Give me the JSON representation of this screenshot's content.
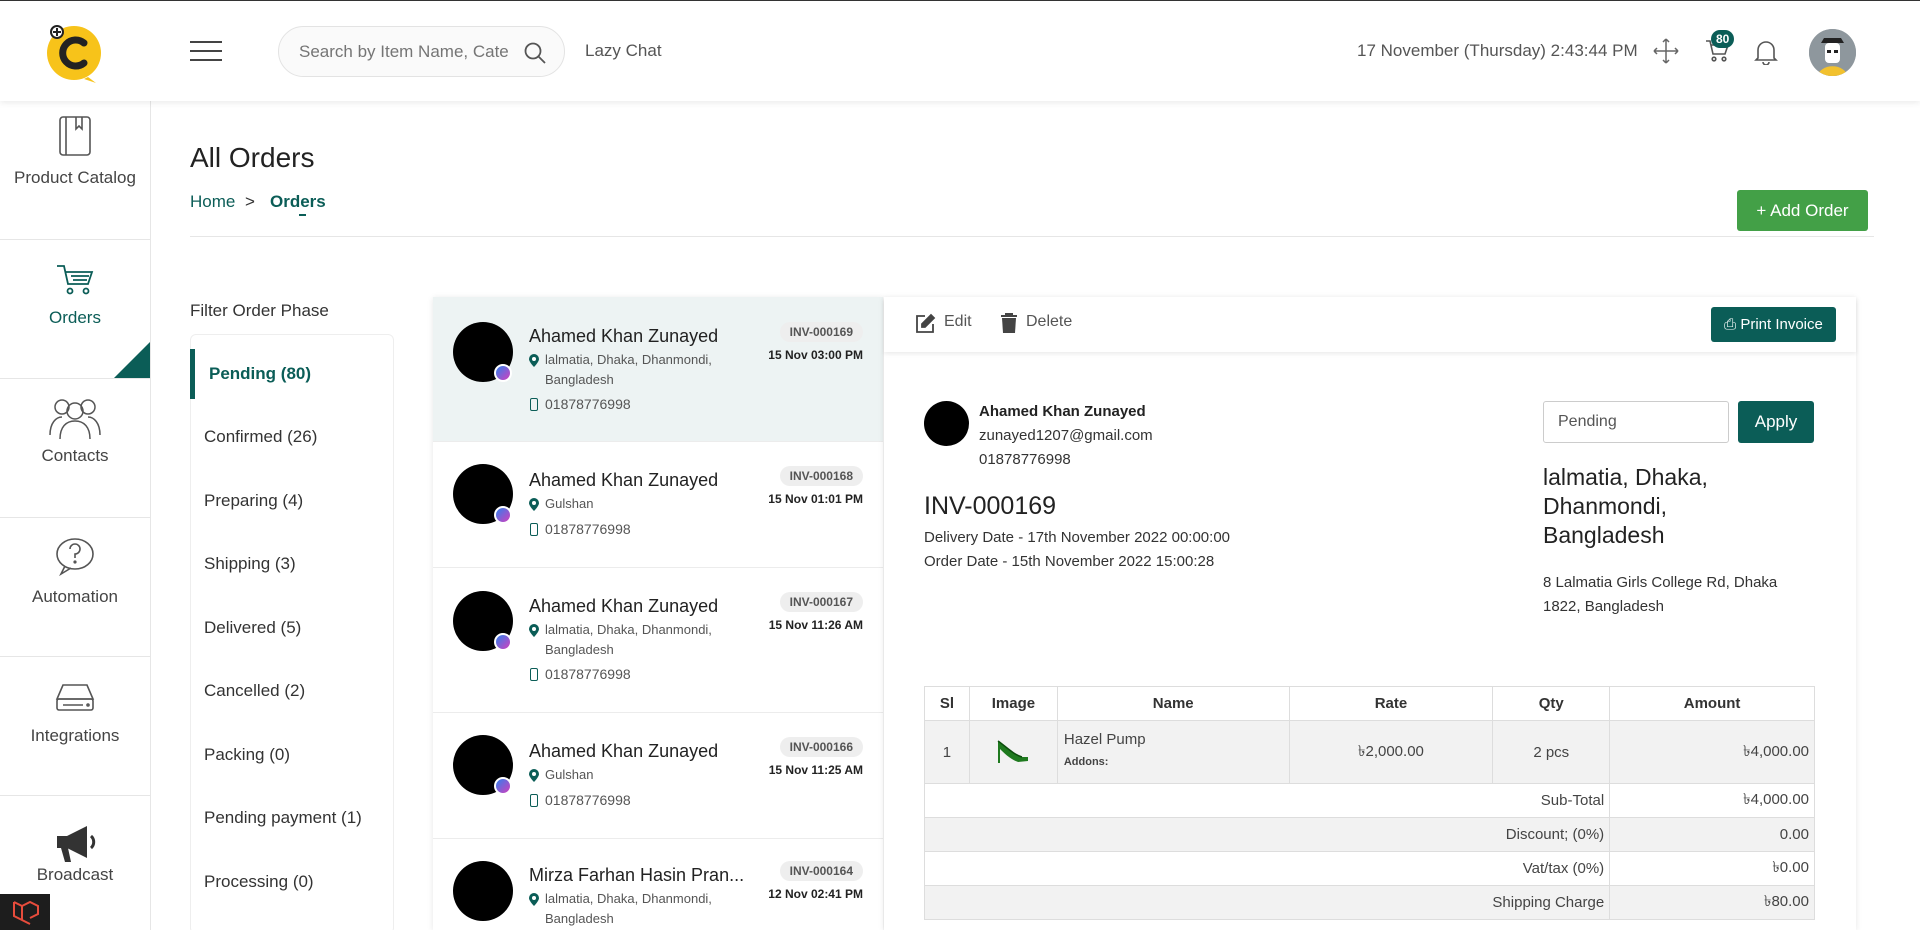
{
  "header": {
    "search_placeholder": "Search by Item Name, Category",
    "lazy_chat": "Lazy Chat",
    "datetime": "17 November (Thursday) 2:43:44 PM",
    "cart_count": "80"
  },
  "sidebar": {
    "items": [
      {
        "label": "Product Catalog"
      },
      {
        "label": "Orders"
      },
      {
        "label": "Contacts"
      },
      {
        "label": "Automation"
      },
      {
        "label": "Integrations"
      },
      {
        "label": "Broadcast"
      }
    ]
  },
  "page": {
    "title": "All Orders",
    "breadcrumb_home": "Home",
    "breadcrumb_sep": ">",
    "breadcrumb_current": "Orders",
    "add_order": "+ Add Order"
  },
  "filter": {
    "title": "Filter Order Phase",
    "items": [
      {
        "label": "Pending (80)"
      },
      {
        "label": "Confirmed (26)"
      },
      {
        "label": "Preparing (4)"
      },
      {
        "label": "Shipping (3)"
      },
      {
        "label": "Delivered (5)"
      },
      {
        "label": "Cancelled (2)"
      },
      {
        "label": "Packing (0)"
      },
      {
        "label": "Pending payment (1)"
      },
      {
        "label": "Processing (0)"
      }
    ]
  },
  "orders": [
    {
      "name": "Ahamed Khan Zunayed",
      "location": "lalmatia, Dhaka, Dhanmondi, Bangladesh",
      "phone": "01878776998",
      "invoice": "INV-000169",
      "date": "15 Nov 03:00 PM"
    },
    {
      "name": "Ahamed Khan Zunayed",
      "location": "Gulshan",
      "phone": "01878776998",
      "invoice": "INV-000168",
      "date": "15 Nov 01:01 PM"
    },
    {
      "name": "Ahamed Khan Zunayed",
      "location": "lalmatia, Dhaka, Dhanmondi, Bangladesh",
      "phone": "01878776998",
      "invoice": "INV-000167",
      "date": "15 Nov 11:26 AM"
    },
    {
      "name": "Ahamed Khan Zunayed",
      "location": "Gulshan",
      "phone": "01878776998",
      "invoice": "INV-000166",
      "date": "15 Nov 11:25 AM"
    },
    {
      "name": "Mirza Farhan Hasin Pran...",
      "location": "lalmatia, Dhaka, Dhanmondi, Bangladesh",
      "phone": "",
      "invoice": "INV-000164",
      "date": "12 Nov 02:41 PM"
    }
  ],
  "detail": {
    "edit": "Edit",
    "delete": "Delete",
    "print": "Print Invoice",
    "customer_name": "Ahamed Khan Zunayed",
    "customer_email": "zunayed1207@gmail.com",
    "customer_phone": "01878776998",
    "invoice": "INV-000169",
    "delivery_date": "Delivery Date - 17th November 2022 00:00:00",
    "order_date": "Order Date - 15th November 2022 15:00:28",
    "status_value": "Pending",
    "apply": "Apply",
    "address_big": "lalmatia, Dhaka, Dhanmondi, Bangladesh",
    "address_small": "8 Lalmatia Girls College Rd, Dhaka 1822, Bangladesh",
    "table": {
      "headers": [
        "Sl",
        "Image",
        "Name",
        "Rate",
        "Qty",
        "Amount"
      ],
      "rows": [
        {
          "sl": "1",
          "name": "Hazel Pump",
          "addons": "Addons:",
          "rate": "৳2,000.00",
          "qty": "2 pcs",
          "amount": "৳4,000.00"
        }
      ],
      "summary": [
        {
          "label": "Sub-Total",
          "value": "৳4,000.00"
        },
        {
          "label": "Discount; (0%)",
          "value": "0.00"
        },
        {
          "label": "Vat/tax (0%)",
          "value": "৳0.00"
        },
        {
          "label": "Shipping Charge",
          "value": "৳80.00"
        }
      ]
    }
  },
  "colors": {
    "brand": "#0b5d57",
    "add_button": "#43a047"
  }
}
